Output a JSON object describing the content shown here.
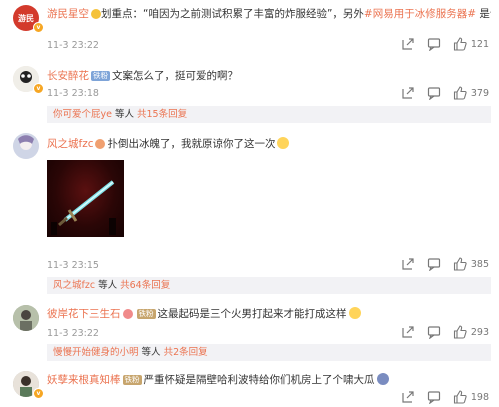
{
  "comments": [
    {
      "user": "游民星空",
      "text_prefix": "划重点：“咱因为之前测试积累了丰富的炸服经验”，另外",
      "link": "#网易用于冰修服务器#",
      "text_suffix": " 是认真的吗",
      "date": "11-3 23:22",
      "likes": "121",
      "avatar_label": "游民"
    },
    {
      "user": "长安醉花",
      "badge": "铁粉",
      "text": "文案怎么了，挺可爱的啊？",
      "date": "11-3 23:18",
      "likes": "379",
      "reply_user": "你可爱个屁ye",
      "reply_mid": " 等人 ",
      "reply_total": "共15条回复"
    },
    {
      "user": "风之城fzc",
      "text": "扑倒出冰魄了，我就原谅你了这一次",
      "date": "11-3 23:15",
      "likes": "385",
      "reply_user": "风之城fzc",
      "reply_mid": " 等人 ",
      "reply_total": "共64条回复"
    },
    {
      "user": "彼岸花下三生石",
      "badge": "铁粉",
      "text": "这最起码是三个火男打起来才能打成这样",
      "date": "11-3 23:22",
      "likes": "293",
      "reply_user": "慢慢开始健身的小明",
      "reply_mid": " 等人 ",
      "reply_total": "共2条回复"
    },
    {
      "user": "妖孽来根真知棒",
      "badge": "铁粉",
      "text": "严重怀疑是隔壁哈利波特给你们机房上了个啸大瓜",
      "date": "11-3 23:18",
      "likes": "198"
    }
  ],
  "colors": {
    "accent": "#eb7350",
    "meta": "#999999",
    "subbg": "#f2f2f5"
  },
  "icons": [
    "share-icon",
    "comment-icon",
    "like-icon"
  ]
}
